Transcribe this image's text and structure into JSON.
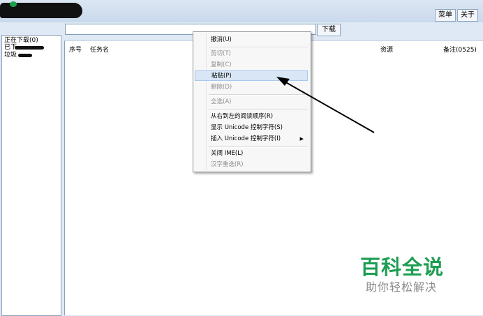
{
  "toolbar": {
    "menu_label": "菜单",
    "about_label": "关于",
    "download_label": "下载"
  },
  "url_input": {
    "value": ""
  },
  "sidebar": {
    "items": [
      {
        "label": "正在下载(0)"
      },
      {
        "label": "已下"
      },
      {
        "label": "垃圾"
      }
    ]
  },
  "table": {
    "columns": [
      "序号",
      "任务名",
      "资源",
      "备注(0525)"
    ]
  },
  "context_menu": {
    "items": [
      {
        "label": "撤消(U)",
        "enabled": true
      },
      {
        "label": "剪切(T)",
        "enabled": false
      },
      {
        "label": "复制(C)",
        "enabled": false
      },
      {
        "label": "粘贴(P)",
        "enabled": true,
        "highlighted": true
      },
      {
        "label": "删除(D)",
        "enabled": false
      },
      {
        "label": "全选(A)",
        "enabled": false
      },
      {
        "label": "从右到左的阅读顺序(R)",
        "enabled": true
      },
      {
        "label": "显示 Unicode 控制字符(S)",
        "enabled": true
      },
      {
        "label": "插入 Unicode 控制字符(I)",
        "enabled": true,
        "has_submenu": true
      },
      {
        "label": "关闭 IME(L)",
        "enabled": true
      },
      {
        "label": "汉字重选(R)",
        "enabled": false
      }
    ]
  },
  "watermark": {
    "title": "百科全说",
    "subtitle": "助你轻松解决"
  },
  "colors": {
    "watermark_green": "#1d9e53",
    "annotation_arrow": "#000000",
    "menu_highlight": "#d8e6f6"
  },
  "icons": {
    "submenu": "chevron-right-icon"
  }
}
